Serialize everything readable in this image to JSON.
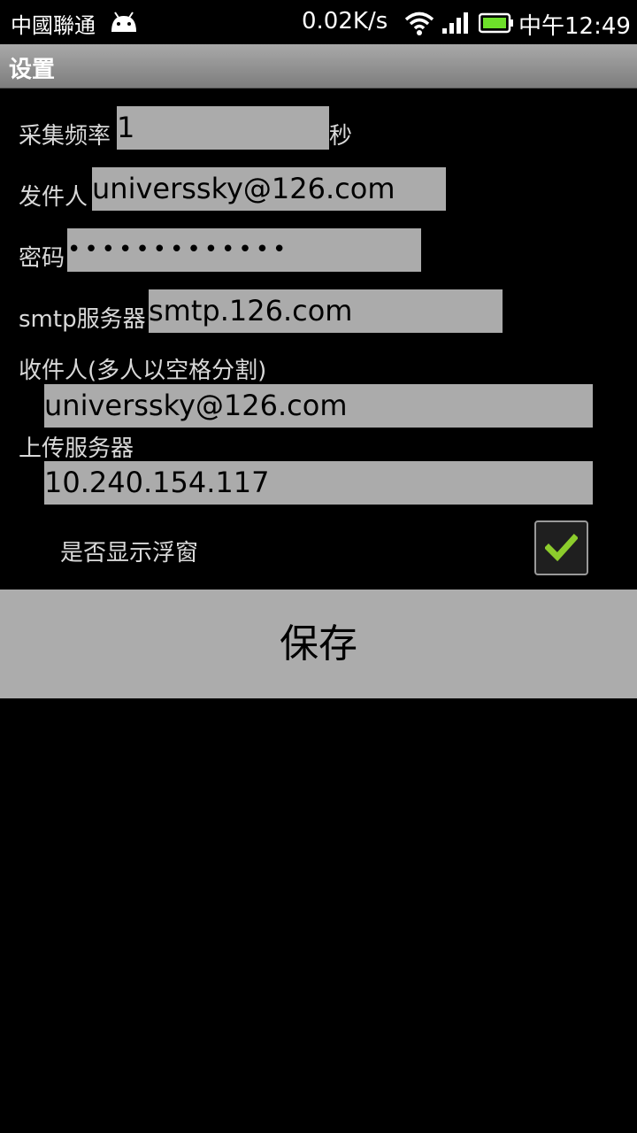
{
  "status_bar": {
    "carrier": "中國聯通",
    "speed": "0.02K/s",
    "clock": "中午12:49",
    "icons": [
      "android-icon",
      "wifi-icon",
      "signal-icon",
      "battery-icon"
    ]
  },
  "title_bar": {
    "title": "设置"
  },
  "form": {
    "interval_label": "采集频率",
    "interval_value": "1",
    "interval_unit": "秒",
    "sender_label": "发件人",
    "sender_value": "universsky@126.com",
    "password_label": "密码",
    "password_value": "•••••••••••••",
    "smtp_label": "smtp服务器",
    "smtp_value": "smtp.126.com",
    "recipients_label": "收件人(多人以空格分割)",
    "recipients_value": "universsky@126.com",
    "upload_server_label": "上传服务器",
    "upload_server_value": "10.240.154.117",
    "float_window_label": "是否显示浮窗",
    "float_window_checked": true
  },
  "save_button": {
    "label": "保存"
  },
  "colors": {
    "background": "#000000",
    "field": "#ababab",
    "button": "#acacac",
    "check": "#8ccc2c"
  }
}
